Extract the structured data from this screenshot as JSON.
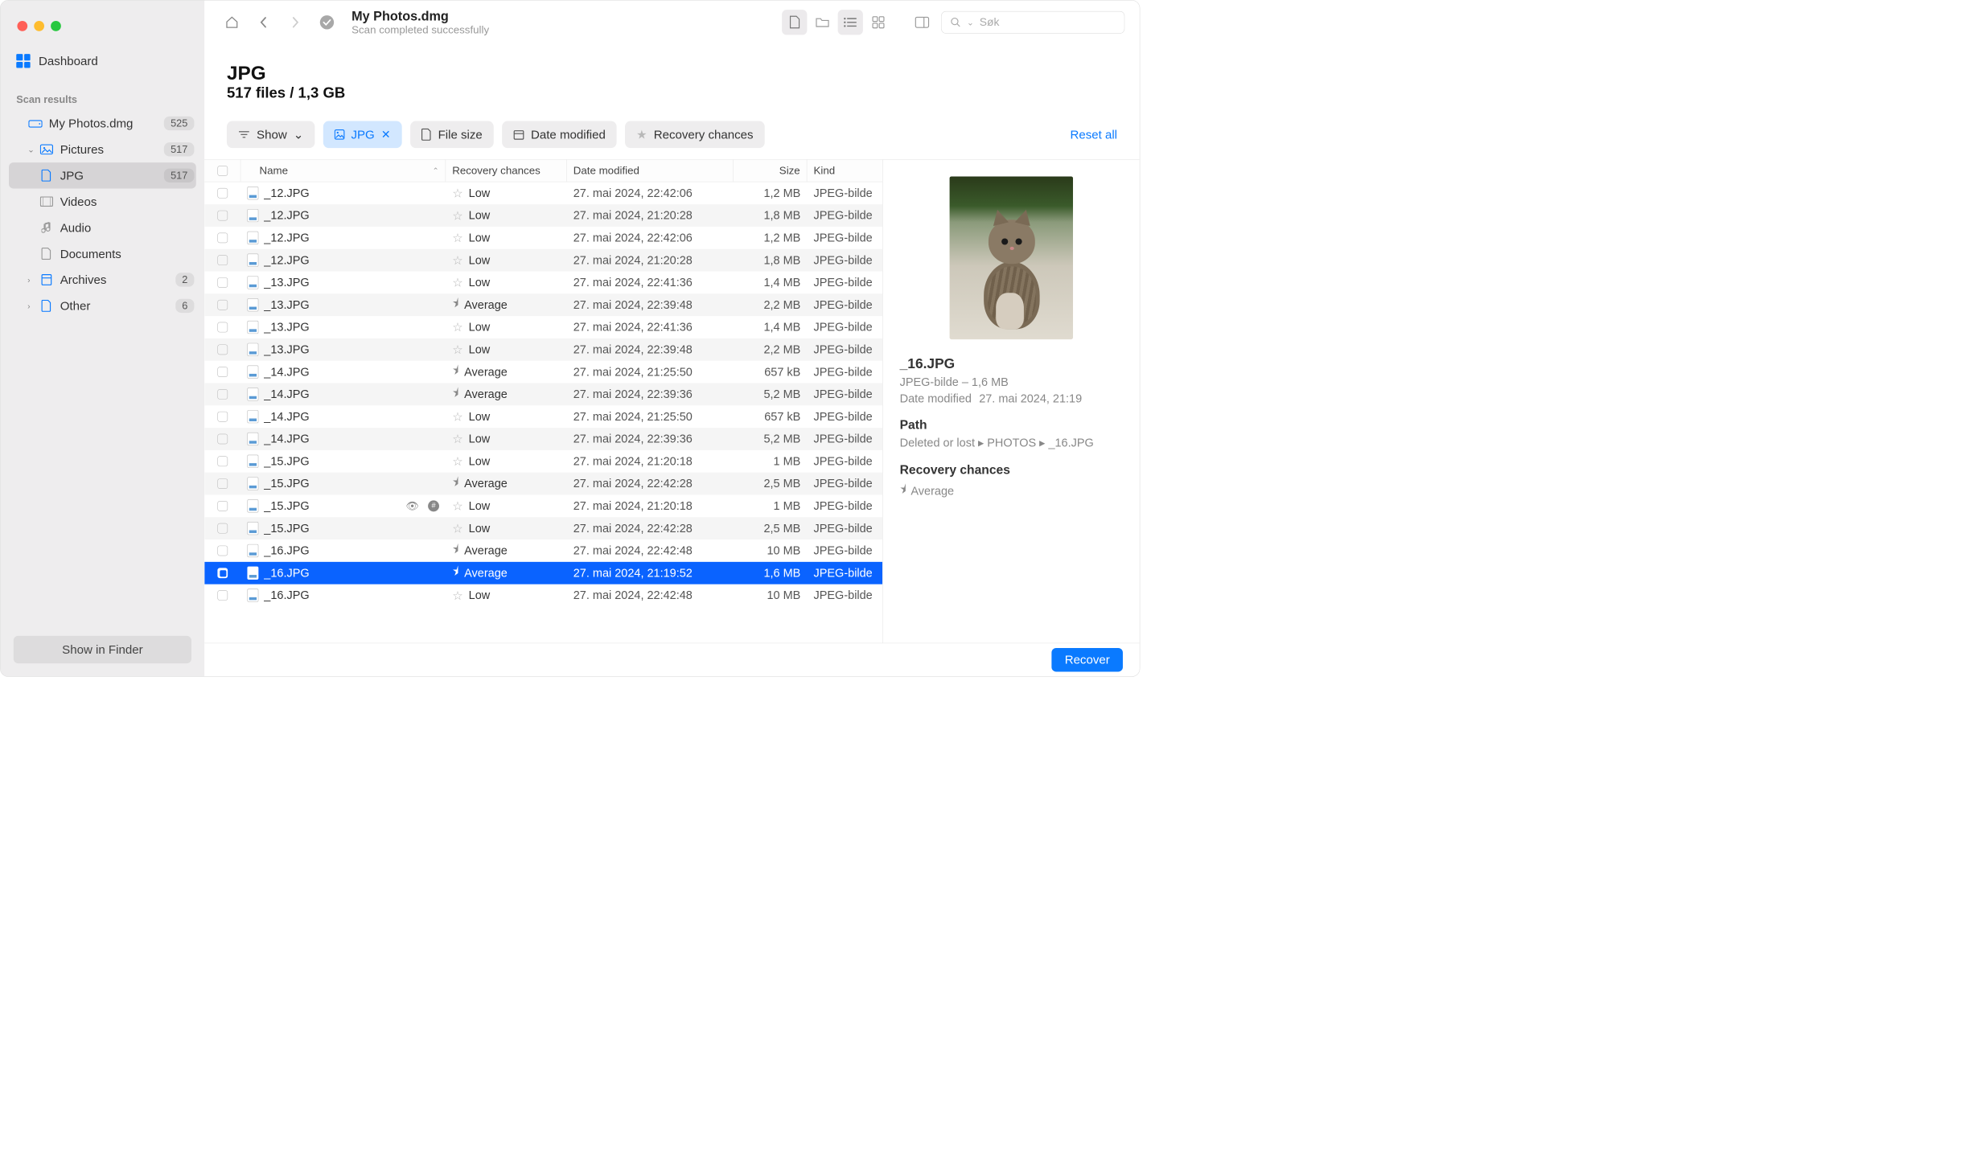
{
  "sidebar": {
    "dashboard": "Dashboard",
    "section": "Scan results",
    "items": [
      {
        "label": "My Photos.dmg",
        "badge": "525",
        "icon": "drive"
      },
      {
        "label": "Pictures",
        "badge": "517",
        "icon": "pictures",
        "expanded": true
      },
      {
        "label": "JPG",
        "badge": "517",
        "icon": "file",
        "selected": true
      },
      {
        "label": "Videos",
        "icon": "video"
      },
      {
        "label": "Audio",
        "icon": "audio"
      },
      {
        "label": "Documents",
        "icon": "doc"
      },
      {
        "label": "Archives",
        "badge": "2",
        "icon": "archive",
        "chev": true
      },
      {
        "label": "Other",
        "badge": "6",
        "icon": "other",
        "chev": true
      }
    ],
    "show_finder": "Show in Finder"
  },
  "toolbar": {
    "title": "My Photos.dmg",
    "subtitle": "Scan completed successfully",
    "search_placeholder": "Søk"
  },
  "heading": {
    "title": "JPG",
    "subtitle": "517 files / 1,3 GB"
  },
  "filters": {
    "show": "Show",
    "jpg": "JPG",
    "file_size": "File size",
    "date_modified": "Date modified",
    "recovery_chances": "Recovery chances",
    "reset": "Reset all"
  },
  "columns": {
    "name": "Name",
    "recovery": "Recovery chances",
    "date": "Date modified",
    "size": "Size",
    "kind": "Kind"
  },
  "rows": [
    {
      "name": "_12.JPG",
      "rec": "Low",
      "date": "27. mai 2024, 22:42:06",
      "size": "1,2 MB",
      "kind": "JPEG-bilde"
    },
    {
      "name": "_12.JPG",
      "rec": "Low",
      "date": "27. mai 2024, 21:20:28",
      "size": "1,8 MB",
      "kind": "JPEG-bilde"
    },
    {
      "name": "_12.JPG",
      "rec": "Low",
      "date": "27. mai 2024, 22:42:06",
      "size": "1,2 MB",
      "kind": "JPEG-bilde"
    },
    {
      "name": "_12.JPG",
      "rec": "Low",
      "date": "27. mai 2024, 21:20:28",
      "size": "1,8 MB",
      "kind": "JPEG-bilde"
    },
    {
      "name": "_13.JPG",
      "rec": "Low",
      "date": "27. mai 2024, 22:41:36",
      "size": "1,4 MB",
      "kind": "JPEG-bilde"
    },
    {
      "name": "_13.JPG",
      "rec": "Average",
      "date": "27. mai 2024, 22:39:48",
      "size": "2,2 MB",
      "kind": "JPEG-bilde"
    },
    {
      "name": "_13.JPG",
      "rec": "Low",
      "date": "27. mai 2024, 22:41:36",
      "size": "1,4 MB",
      "kind": "JPEG-bilde"
    },
    {
      "name": "_13.JPG",
      "rec": "Low",
      "date": "27. mai 2024, 22:39:48",
      "size": "2,2 MB",
      "kind": "JPEG-bilde"
    },
    {
      "name": "_14.JPG",
      "rec": "Average",
      "date": "27. mai 2024, 21:25:50",
      "size": "657 kB",
      "kind": "JPEG-bilde"
    },
    {
      "name": "_14.JPG",
      "rec": "Average",
      "date": "27. mai 2024, 22:39:36",
      "size": "5,2 MB",
      "kind": "JPEG-bilde"
    },
    {
      "name": "_14.JPG",
      "rec": "Low",
      "date": "27. mai 2024, 21:25:50",
      "size": "657 kB",
      "kind": "JPEG-bilde"
    },
    {
      "name": "_14.JPG",
      "rec": "Low",
      "date": "27. mai 2024, 22:39:36",
      "size": "5,2 MB",
      "kind": "JPEG-bilde"
    },
    {
      "name": "_15.JPG",
      "rec": "Low",
      "date": "27. mai 2024, 21:20:18",
      "size": "1 MB",
      "kind": "JPEG-bilde"
    },
    {
      "name": "_15.JPG",
      "rec": "Average",
      "date": "27. mai 2024, 22:42:28",
      "size": "2,5 MB",
      "kind": "JPEG-bilde"
    },
    {
      "name": "_15.JPG",
      "rec": "Low",
      "date": "27. mai 2024, 21:20:18",
      "size": "1 MB",
      "kind": "JPEG-bilde",
      "hover": true
    },
    {
      "name": "_15.JPG",
      "rec": "Low",
      "date": "27. mai 2024, 22:42:28",
      "size": "2,5 MB",
      "kind": "JPEG-bilde"
    },
    {
      "name": "_16.JPG",
      "rec": "Average",
      "date": "27. mai 2024, 22:42:48",
      "size": "10 MB",
      "kind": "JPEG-bilde"
    },
    {
      "name": "_16.JPG",
      "rec": "Average",
      "date": "27. mai 2024, 21:19:52",
      "size": "1,6 MB",
      "kind": "JPEG-bilde",
      "selected": true
    },
    {
      "name": "_16.JPG",
      "rec": "Low",
      "date": "27. mai 2024, 22:42:48",
      "size": "10 MB",
      "kind": "JPEG-bilde"
    }
  ],
  "preview": {
    "filename": "_16.JPG",
    "meta": "JPEG-bilde – 1,6 MB",
    "date_label": "Date modified",
    "date": "27. mai 2024, 21:19",
    "path_label": "Path",
    "path": "Deleted or lost ▸ PHOTOS ▸ _16.JPG",
    "rc_label": "Recovery chances",
    "rc": "Average"
  },
  "recover": "Recover"
}
